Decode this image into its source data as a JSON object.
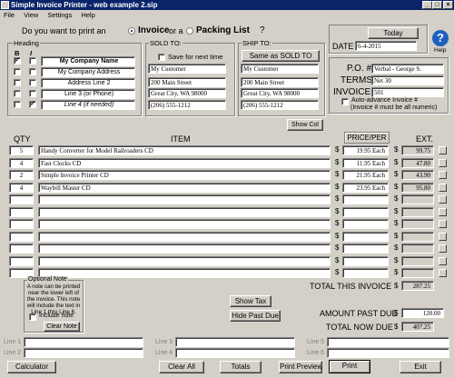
{
  "window": {
    "title": "Simple Invoice Printer - web example 2.sip",
    "min": "_",
    "max": "□",
    "close": "×"
  },
  "menu": [
    "File",
    "View",
    "Settings",
    "Help"
  ],
  "doc_type": {
    "prompt": "Do you want to print an",
    "invoice": "Invoice",
    "or_a": "or a",
    "packing": "Packing List",
    "q": "?"
  },
  "heading": {
    "title": "Heading",
    "col_b": "B",
    "col_i": "I",
    "lines": [
      {
        "text": "My Company Name",
        "bold": true,
        "italic": false
      },
      {
        "text": "My Company Address",
        "bold": false,
        "italic": false
      },
      {
        "text": "Address Line 2",
        "bold": false,
        "italic": false
      },
      {
        "text": "Line 3 (or Phone)",
        "bold": false,
        "italic": false
      },
      {
        "text": "Line 4 (if needed)",
        "bold": false,
        "italic": true
      }
    ]
  },
  "sold_to": {
    "title": "SOLD TO:",
    "save_label": "Save for next time",
    "lines": [
      "My Customer",
      "200 Main Street",
      "Great City, WA 98000",
      "(206) 555-1212"
    ]
  },
  "ship_to": {
    "title": "SHIP TO:",
    "same_button": "Same as SOLD TO",
    "lines": [
      "My Customer",
      "200 Main Street",
      "Great City, WA 98000",
      "(206) 555-1212"
    ]
  },
  "today_button": "Today",
  "date_label": "DATE",
  "date_value": "6-4-2015",
  "help_label": "Help",
  "help_icon": "help-icon",
  "po_label": "P.O. #",
  "po_value": "Verbal - George S.",
  "terms_label": "TERMS",
  "terms_value": "Net 30",
  "invoice_label": "INVOICE #",
  "invoice_value": "501",
  "auto_advance": "Auto-advance Invoice #",
  "auto_advance_note": "(Invoice # must be all numeric)",
  "show_col_button": "Show Col",
  "columns": {
    "qty": "QTY",
    "item": "ITEM",
    "price": "PRICE/PER",
    "ext": "EXT."
  },
  "currency": "$",
  "items": [
    {
      "qty": "5",
      "item": "Handy Converter for Model Railroaders CD",
      "price": "19.95 Each",
      "ext": "99.75"
    },
    {
      "qty": "4",
      "item": "Fast Clocks CD",
      "price": "11.95 Each",
      "ext": "47.80"
    },
    {
      "qty": "2",
      "item": "Simple Invoice Printer CD",
      "price": "21.95 Each",
      "ext": "43.90"
    },
    {
      "qty": "4",
      "item": "Waybill Master CD",
      "price": "23.95 Each",
      "ext": "95.80"
    }
  ],
  "empty_rows": 7,
  "optional_note": {
    "title": "Optional Note",
    "text": "A note can be printed near the lower left of the invoice. This note will include the text in Line 1 thru Line 6.",
    "include": "Include note",
    "clear": "Clear Note"
  },
  "show_tax_button": "Show Tax",
  "hide_past_due_button": "Hide Past Due",
  "total_label": "TOTAL THIS INVOICE",
  "total_value": "287.25",
  "past_due_label": "AMOUNT PAST DUE",
  "past_due_value": "120.00",
  "total_now_label": "TOTAL NOW DUE",
  "total_now_value": "407.25",
  "note_lines": [
    "Line 1",
    "Line 2",
    "Line 3",
    "Line 4",
    "Line 5",
    "Line 6"
  ],
  "bottom": {
    "calculator": "Calculator",
    "clear_all": "Clear All",
    "totals": "Totals",
    "print_preview": "Print Preview",
    "print": "Print",
    "exit": "Exit"
  }
}
